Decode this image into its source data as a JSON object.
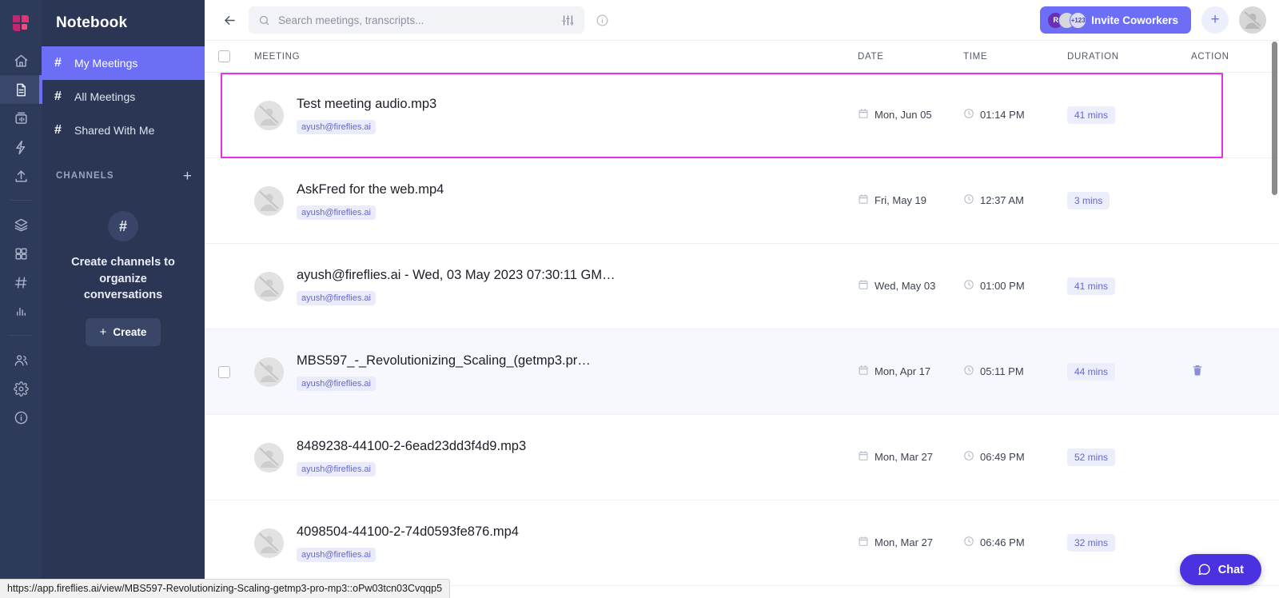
{
  "brand": {
    "logo_name": "fireflies-logo",
    "accent": "#6c6ff5",
    "selection_outline": "#ea2fea"
  },
  "rail": {
    "items": [
      {
        "name": "home-icon",
        "label": "Home",
        "active": false
      },
      {
        "name": "notebook-icon",
        "label": "Notebook",
        "active": true
      },
      {
        "name": "soundbites-icon",
        "label": "Soundbites",
        "active": false
      },
      {
        "name": "apps-icon",
        "label": "Apps",
        "active": false
      },
      {
        "name": "upload-icon",
        "label": "Upload",
        "active": false
      },
      {
        "name": "layers-icon",
        "label": "Topic Tracker",
        "active": false
      },
      {
        "name": "grid-icon",
        "label": "Dashboard",
        "active": false
      },
      {
        "name": "hash-icon",
        "label": "Channels",
        "active": false
      },
      {
        "name": "analytics-icon",
        "label": "Analytics",
        "active": false
      },
      {
        "name": "team-icon",
        "label": "Team",
        "active": false
      },
      {
        "name": "settings-icon",
        "label": "Settings",
        "active": false
      },
      {
        "name": "help-icon",
        "label": "Help",
        "active": false
      }
    ]
  },
  "sidebar": {
    "title": "Notebook",
    "nav": [
      {
        "hash": "#",
        "label": "My Meetings",
        "active": true
      },
      {
        "hash": "#",
        "label": "All Meetings",
        "active": false
      },
      {
        "hash": "#",
        "label": "Shared With Me",
        "active": false
      }
    ],
    "channels": {
      "header": "CHANNELS",
      "add": "+",
      "empty_icon": "#",
      "empty_text": "Create channels to organize conversations",
      "create_label": "Create",
      "create_plus": "+"
    }
  },
  "topbar": {
    "back": "←",
    "search": {
      "placeholder": "Search meetings, transcripts...",
      "value": ""
    },
    "invite_label": "Invite Coworkers",
    "avatars": {
      "initial": "R",
      "overflow": "+123"
    },
    "plus": "+"
  },
  "table": {
    "headers": {
      "meeting": "MEETING",
      "date": "DATE",
      "time": "TIME",
      "duration": "DURATION",
      "action": "ACTION"
    },
    "rows": [
      {
        "title": "Test meeting audio.mp3",
        "owner": "ayush@fireflies.ai",
        "date": "Mon, Jun 05",
        "time": "01:14 PM",
        "duration": "41 mins",
        "selected": true,
        "hovered": false
      },
      {
        "title": "AskFred for the web.mp4",
        "owner": "ayush@fireflies.ai",
        "date": "Fri, May 19",
        "time": "12:37 AM",
        "duration": "3 mins",
        "selected": false,
        "hovered": false
      },
      {
        "title": "ayush@fireflies.ai - Wed, 03 May 2023 07:30:11 GM…",
        "owner": "ayush@fireflies.ai",
        "date": "Wed, May 03",
        "time": "01:00 PM",
        "duration": "41 mins",
        "selected": false,
        "hovered": false
      },
      {
        "title": "MBS597_-_Revolutionizing_Scaling_(getmp3.pr…",
        "owner": "ayush@fireflies.ai",
        "date": "Mon, Apr 17",
        "time": "05:11 PM",
        "duration": "44 mins",
        "selected": false,
        "hovered": true
      },
      {
        "title": "8489238-44100-2-6ead23dd3f4d9.mp3",
        "owner": "ayush@fireflies.ai",
        "date": "Mon, Mar 27",
        "time": "06:49 PM",
        "duration": "52 mins",
        "selected": false,
        "hovered": false
      },
      {
        "title": "4098504-44100-2-74d0593fe876.mp4",
        "owner": "ayush@fireflies.ai",
        "date": "Mon, Mar 27",
        "time": "06:46 PM",
        "duration": "32 mins",
        "selected": false,
        "hovered": false
      }
    ]
  },
  "chat": {
    "label": "Chat"
  },
  "statusbar": {
    "url": "https://app.fireflies.ai/view/MBS597-Revolutionizing-Scaling-getmp3-pro-mp3::oPw03tcn03Cvqqp5"
  }
}
